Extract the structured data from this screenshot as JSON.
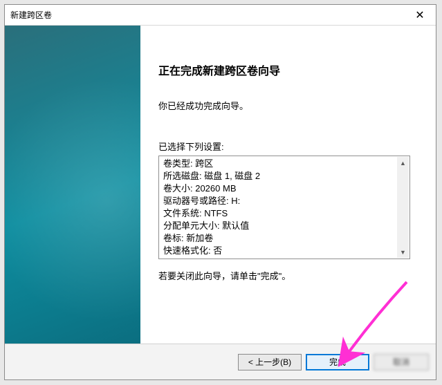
{
  "titlebar": {
    "title": "新建跨区卷",
    "close_glyph": "✕"
  },
  "content": {
    "heading": "正在完成新建跨区卷向导",
    "intro": "你已经成功完成向导。",
    "settings_label": "已选择下列设置:",
    "settings_lines": [
      "卷类型: 跨区",
      "所选磁盘: 磁盘 1, 磁盘 2",
      "卷大小: 20260 MB",
      "驱动器号或路径: H:",
      "文件系统: NTFS",
      "分配单元大小: 默认值",
      "卷标: 新加卷",
      "快速格式化: 否"
    ],
    "closing": "若要关闭此向导，请单击\"完成\"。"
  },
  "scrollbar": {
    "up_glyph": "▲",
    "down_glyph": "▼"
  },
  "footer": {
    "back_label": "< 上一步(B)",
    "finish_label": "完成",
    "cancel_label": "取消"
  },
  "colors": {
    "arrow": "#ff2fd4"
  }
}
